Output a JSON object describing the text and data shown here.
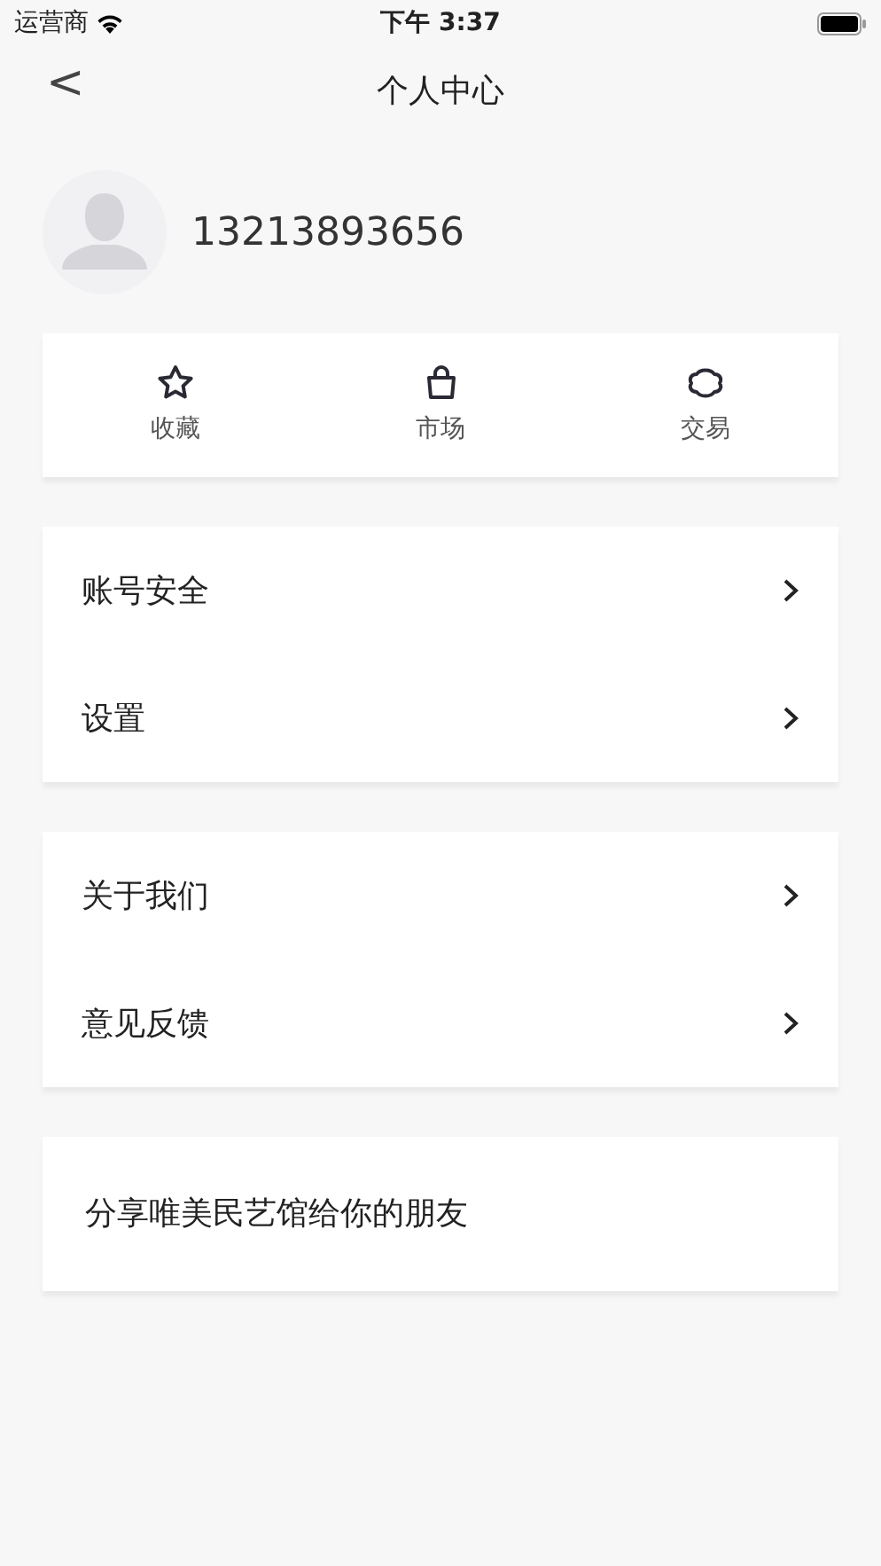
{
  "status_bar": {
    "carrier": "运营商",
    "time": "下午 3:37"
  },
  "nav": {
    "back": "<",
    "title": "个人中心"
  },
  "profile": {
    "phone": "13213893656"
  },
  "quick_actions": [
    {
      "kind": "star",
      "label": "收藏"
    },
    {
      "kind": "bag",
      "label": "市场"
    },
    {
      "kind": "cloud",
      "label": "交易"
    }
  ],
  "menu_groups": [
    {
      "items": [
        {
          "label": "账号安全",
          "kind": "link"
        },
        {
          "label": "设置",
          "kind": "link"
        }
      ]
    },
    {
      "items": [
        {
          "label": "关于我们",
          "kind": "link"
        },
        {
          "label": "意见反馈",
          "kind": "link"
        }
      ]
    },
    {
      "items": [
        {
          "label": "分享唯美民艺馆给你的朋友",
          "kind": "plain"
        }
      ]
    }
  ]
}
